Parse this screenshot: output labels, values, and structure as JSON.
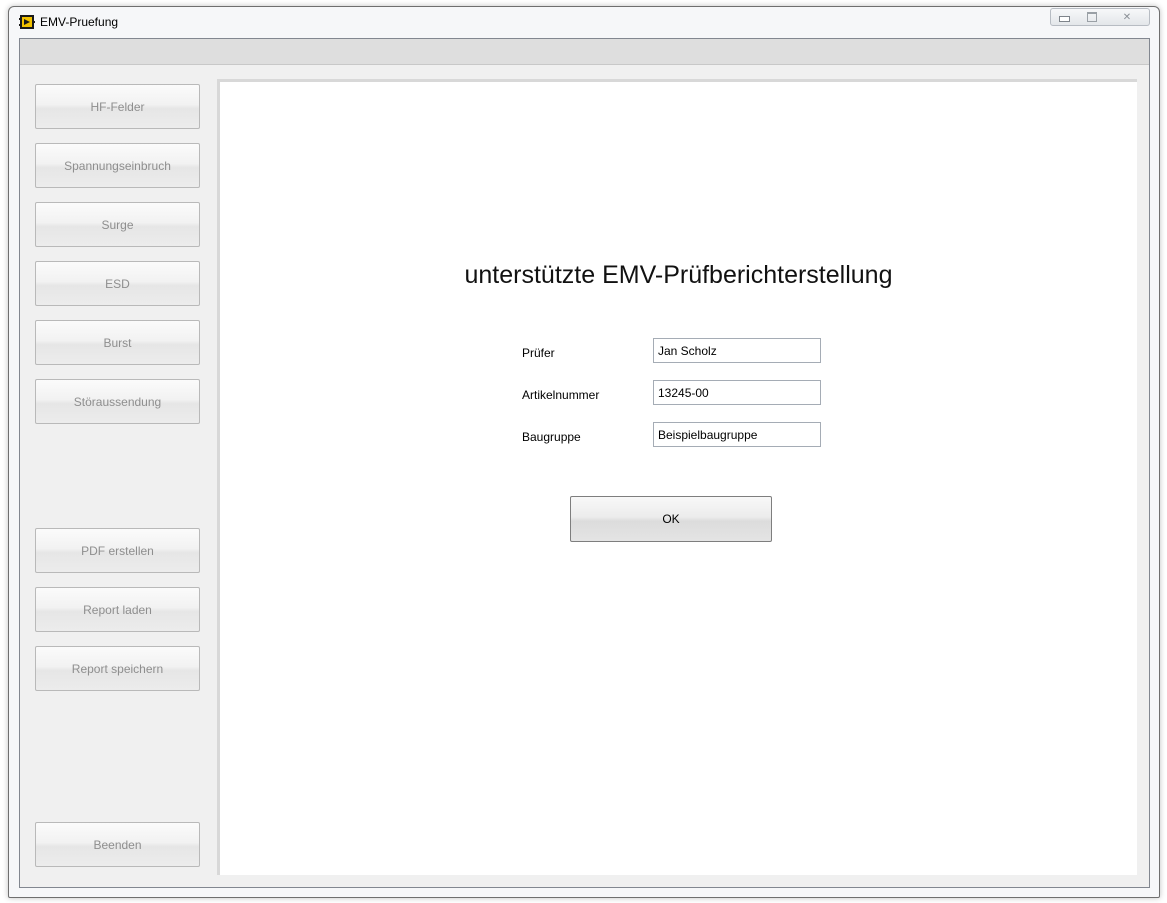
{
  "window": {
    "title": "EMV-Pruefung",
    "icon": "labview-app-icon",
    "controls": [
      "minimize-icon",
      "maximize-icon",
      "close-icon"
    ]
  },
  "sidebar": {
    "items": [
      {
        "label": "HF-Felder"
      },
      {
        "label": "Spannungseinbruch"
      },
      {
        "label": "Surge"
      },
      {
        "label": "ESD"
      },
      {
        "label": "Burst"
      },
      {
        "label": "Störaussendung"
      },
      {
        "label": "PDF erstellen"
      },
      {
        "label": "Report laden"
      },
      {
        "label": "Report speichern"
      },
      {
        "label": "Beenden"
      }
    ]
  },
  "main": {
    "heading": "unterstützte EMV-Prüfberichterstellung",
    "fields": [
      {
        "label": "Prüfer",
        "value": "Jan Scholz"
      },
      {
        "label": "Artikelnummer",
        "value": "13245-00"
      },
      {
        "label": "Baugruppe",
        "value": "Beispielbaugruppe"
      }
    ],
    "ok_label": "OK"
  },
  "colors": {
    "window_bg": "#f0f0f0",
    "toolbar_bg": "#dedede",
    "panel_bg": "#ffffff",
    "disabled_text": "#8e8e8e"
  }
}
